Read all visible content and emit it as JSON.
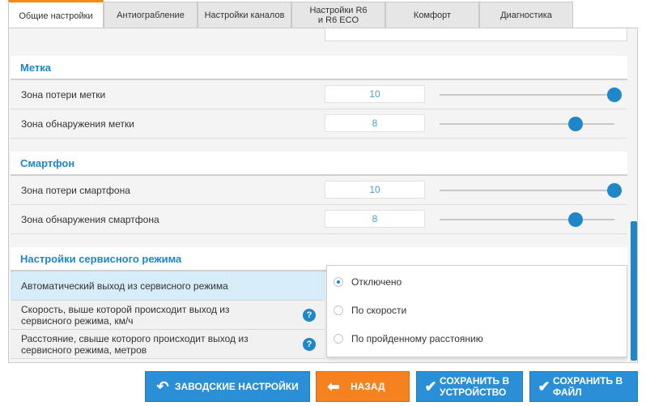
{
  "tabs": [
    {
      "label": "Общие настройки",
      "active": true
    },
    {
      "label": "Антиограбление",
      "active": false
    },
    {
      "label": "Настройки каналов",
      "active": false
    },
    {
      "label": "Настройки R6 и R6 ECO",
      "active": false
    },
    {
      "label": "Комфорт",
      "active": false
    },
    {
      "label": "Диагностика",
      "active": false
    }
  ],
  "tag_section": {
    "title": "Метка",
    "rows": [
      {
        "label": "Зона потери метки",
        "value": "10",
        "slider_fraction": 1.0
      },
      {
        "label": "Зона обнаружения метки",
        "value": "8",
        "slider_fraction": 0.78
      }
    ]
  },
  "smartphone_section": {
    "title": "Смартфон",
    "rows": [
      {
        "label": "Зона потери смартфона",
        "value": "10",
        "slider_fraction": 1.0
      },
      {
        "label": "Зона обнаружения смартфона",
        "value": "8",
        "slider_fraction": 0.78
      }
    ]
  },
  "service_section": {
    "title": "Настройки сервисного режима",
    "rows": [
      {
        "label": "Автоматический выход из сервисного режима"
      },
      {
        "label": "Скорость, выше которой происходит выход из сервисного режима, км/ч"
      },
      {
        "label": "Расстояние, свыше которого происходит выход из сервисного режима, метров"
      }
    ],
    "help_glyph": "?",
    "dropdown_options": [
      {
        "label": "Отключено",
        "selected": true
      },
      {
        "label": "По скорости",
        "selected": false
      },
      {
        "label": "По пройденному расстоянию",
        "selected": false
      }
    ]
  },
  "buttons": {
    "factory": "ЗАВОДСКИЕ НАСТРОЙКИ",
    "back": "НАЗАД",
    "save_device_line1": "СОХРАНИТЬ В",
    "save_device_line2": "УСТРОЙСТВО",
    "save_file_line1": "СОХРАНИТЬ В",
    "save_file_line2": "ФАЙЛ"
  },
  "colors": {
    "accent": "#1f86c8",
    "button_blue": "#2b8fd8",
    "button_orange": "#f5821f",
    "active_tab_border": "#f08a1a"
  },
  "icons": {
    "factory": "undo-arrow-icon",
    "back": "left-arrow-icon",
    "save": "checkmark-icon",
    "help": "question-icon"
  }
}
